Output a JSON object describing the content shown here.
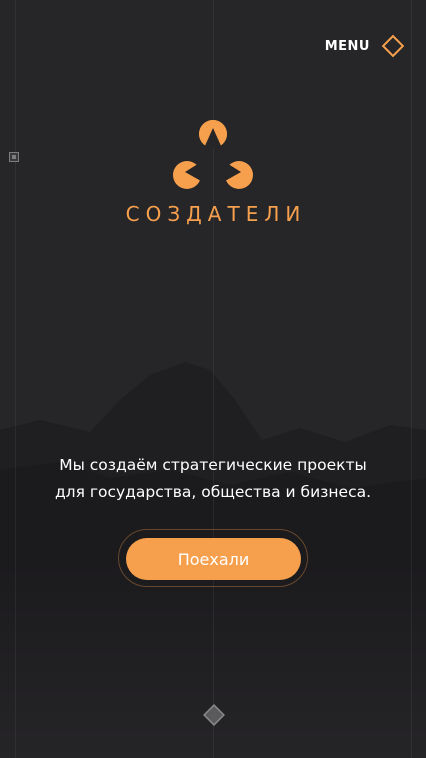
{
  "header": {
    "menu_label": "MENU"
  },
  "brand": {
    "name": "СОЗДАТЕЛИ"
  },
  "hero": {
    "tagline_line1": "Мы создаём стратегические проекты",
    "tagline_line2": "для государства, общества и бизнеса.",
    "cta_label": "Поехали"
  },
  "icons": {
    "menu": "diamond-icon",
    "logo": "triangle-circles-logo",
    "scroll": "diamond-down-icon",
    "side_marker": "square-marker-icon"
  },
  "colors": {
    "accent": "#f6a04d",
    "background": "#262528",
    "text": "#ffffff"
  }
}
